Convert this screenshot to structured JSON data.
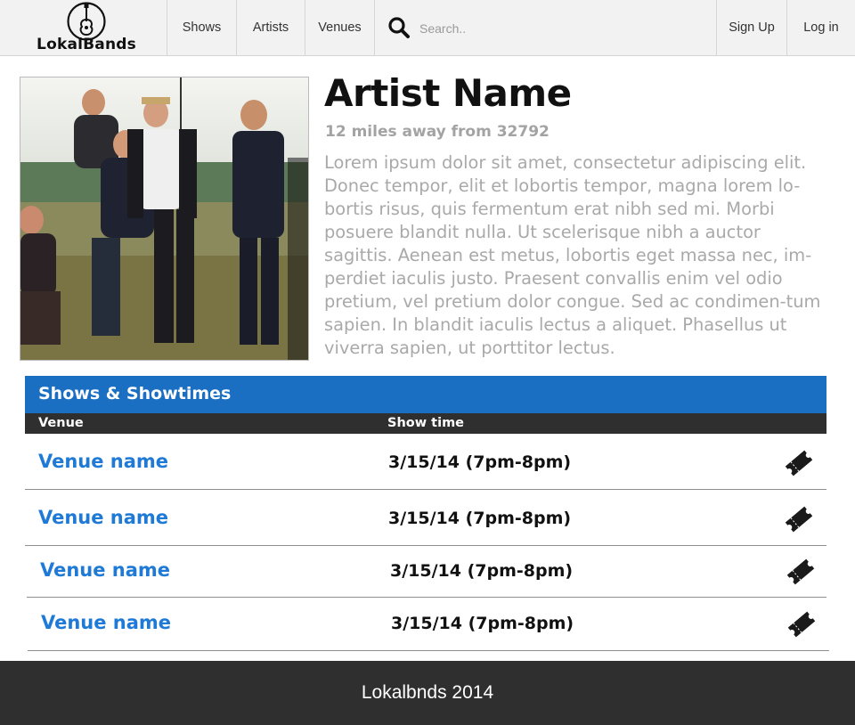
{
  "header": {
    "logo_text": "LokalBands",
    "nav": {
      "shows": "Shows",
      "artists": "Artists",
      "venues": "Venues"
    },
    "search": {
      "placeholder": "Search..",
      "icon": "search-icon"
    },
    "auth": {
      "signup": "Sign Up",
      "login": "Log in"
    }
  },
  "artist": {
    "name": "Artist Name",
    "distance": "12 miles away from 32792",
    "bio": "Lorem ipsum dolor sit amet, consectetur adipiscing elit. Donec tempor, elit et lobortis tempor, magna lorem lo-bortis risus, quis fermentum erat nibh sed mi. Morbi posuere blandit nulla. Ut scelerisque nibh a auctor sagittis. Aenean est metus, lobortis eget massa nec, im-perdiet iaculis justo. Praesent convallis enim vel odio pretium, vel pretium dolor congue. Sed ac condimen-tum sapien. In blandit iaculis lectus a aliquet. Phasellus ut viverra sapien, ut porttitor lectus."
  },
  "shows": {
    "title": "Shows & Showtimes",
    "columns": {
      "venue": "Venue",
      "time": "Show time"
    },
    "rows": [
      {
        "venue": "Venue name",
        "time": "3/15/14 (7pm-8pm)",
        "icon": "ticket-icon"
      },
      {
        "venue": "Venue name",
        "time": "3/15/14 (7pm-8pm)",
        "icon": "ticket-icon"
      },
      {
        "venue": "Venue name",
        "time": "3/15/14 (7pm-8pm)",
        "icon": "ticket-icon"
      },
      {
        "venue": "Venue name",
        "time": "3/15/14 (7pm-8pm)",
        "icon": "ticket-icon"
      }
    ]
  },
  "footer": {
    "text": "Lokalbnds 2014"
  },
  "colors": {
    "accent_blue": "#1a6fc2",
    "link_blue": "#1e7ad6",
    "dark_bar": "#2f2f2f",
    "header_bg": "#f2f2f2"
  }
}
